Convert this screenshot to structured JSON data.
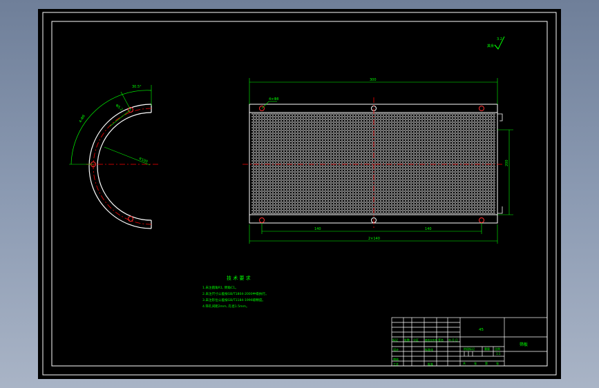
{
  "colors": {
    "background": "#000000",
    "frame": "#ffffff",
    "dimension": "#00ff00",
    "centerline": "#ff0000",
    "outline": "#ffffff",
    "hole": "#ff3030",
    "mesh": "#d8d8d8"
  },
  "roughness": {
    "value": "3.2",
    "prefix": "其余"
  },
  "front_view": {
    "overall_width_dim": "300",
    "hole_spec": "4×Φ8",
    "height_dim": "200",
    "left_spacing_dim": "140",
    "right_spacing_dim": "140",
    "total_bottom_dim": "2×140"
  },
  "side_view": {
    "angle_dim": "30.5°",
    "arc_len_dim": "Φ5.2",
    "hole_dim": "4-Φ8",
    "radius_dim": "R100"
  },
  "notes": {
    "title": "技 术 要 求",
    "lines": [
      "1.未注圆角R1,  倒角C1。",
      "2.未注尺寸公差按GB/T1804-2000中级执行。",
      "3.未注形位公差按GB/T1184-1996级精度。",
      "4.筛孔间距2mm,  孔径1.5mm。"
    ]
  },
  "title_block": {
    "material": "45",
    "part_name": "筛板",
    "scale": "1:1",
    "row_labels": [
      "标记",
      "处数",
      "分区",
      "更改文件号",
      "签名",
      "年.月.日"
    ],
    "designer_label": "设计",
    "standard_label": "标准化",
    "stage_label": "阶段标记",
    "weight_label": "重量",
    "scale_label": "比例",
    "reviewer_label": "审核",
    "craft_label": "工艺",
    "approve_label": "批准",
    "sheet_labels": [
      "共",
      "张",
      "第",
      "张"
    ]
  }
}
